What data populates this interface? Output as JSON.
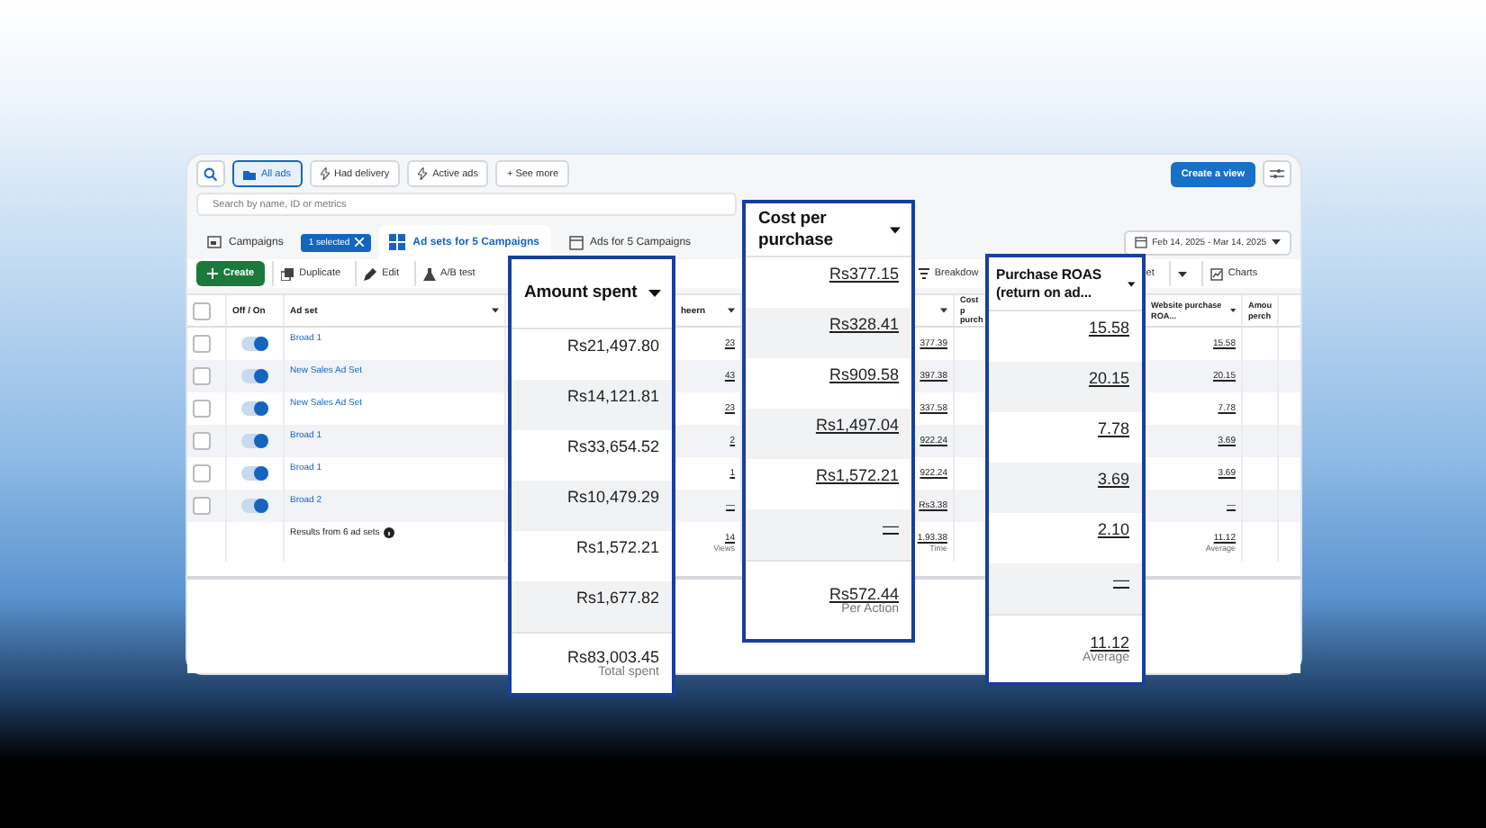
{
  "filters": [
    {
      "label": "All ads",
      "selected": true
    },
    {
      "label": "Had delivery",
      "selected": false
    },
    {
      "label": "Active ads",
      "selected": false
    },
    {
      "label": "+ See more",
      "selected": false
    }
  ],
  "create_view": "Create a view",
  "search": {
    "placeholder": "Search by name, ID or metrics"
  },
  "tabs": [
    {
      "label": "Campaigns",
      "badge": "1 selected",
      "selected": false
    },
    {
      "label": "Ad sets for 5 Campaigns",
      "selected": true
    },
    {
      "label": "Ads for 5 Campaigns",
      "selected": false
    }
  ],
  "date_range": "Feb 14, 2025 - Mar 14, 2025",
  "actions": {
    "create": "Create",
    "duplicate": "Duplicate",
    "edit": "Edit",
    "ab_test": "A/B test",
    "breakdown": "Breakdow",
    "cut_button": "et",
    "charts": "Charts"
  },
  "table": {
    "select_all_checked": false,
    "columns": [
      "Off / On",
      "Ad set",
      "heern",
      "Cost p purch",
      "Website purchase ROA...",
      "Amou perch"
    ],
    "rows": [
      {
        "checked": false,
        "on": true,
        "ad_set": "Broad 1",
        "column_5": "23",
        "column_7": "377.39",
        "website_roas": "15.58"
      },
      {
        "checked": false,
        "on": true,
        "ad_set": "New Sales Ad Set",
        "column_5": "43",
        "column_7": "397.38",
        "website_roas": "20.15"
      },
      {
        "checked": false,
        "on": true,
        "ad_set": "New Sales Ad Set",
        "column_5": "23",
        "column_7": "337.58",
        "website_roas": "7.78"
      },
      {
        "checked": false,
        "on": true,
        "ad_set": "Broad 1",
        "column_5": "2",
        "column_7": "922.24",
        "website_roas": "3.69"
      },
      {
        "checked": false,
        "on": true,
        "ad_set": "Broad 1",
        "column_5": "1",
        "column_7": "922.24",
        "website_roas": "3.69"
      },
      {
        "checked": false,
        "on": true,
        "ad_set": "Broad 2",
        "column_5": "—",
        "column_7": "Rs3.38",
        "website_roas": "—"
      }
    ],
    "summary": {
      "label": "Results from 6 ad sets",
      "column_5": "14",
      "column_5_note": "Views",
      "column_7": "1.93.38",
      "column_7_note": "Time",
      "website_roas": "11.12",
      "website_roas_note": "Average"
    }
  },
  "callouts": [
    {
      "title": "Amount spent",
      "kind": "plain",
      "values": [
        "Rs21,497.80",
        "Rs14,121.81",
        "Rs33,654.52",
        "Rs10,479.29",
        "Rs1,572.21",
        "Rs1,677.82"
      ],
      "total": "Rs83,003.45",
      "total_label": "Total spent"
    },
    {
      "title": "Cost per purchase",
      "kind": "link",
      "values": [
        "Rs377.15",
        "Rs328.41",
        "Rs909.58",
        "Rs1,497.04",
        "Rs1,572.21",
        "—"
      ],
      "total": "Rs572.44",
      "total_label": "Per Action"
    },
    {
      "title": "Purchase ROAS (return on ad...",
      "kind": "link",
      "values": [
        "15.58",
        "20.15",
        "7.78",
        "3.69",
        "2.10",
        "—"
      ],
      "total": "11.12",
      "total_label": "Average"
    }
  ]
}
